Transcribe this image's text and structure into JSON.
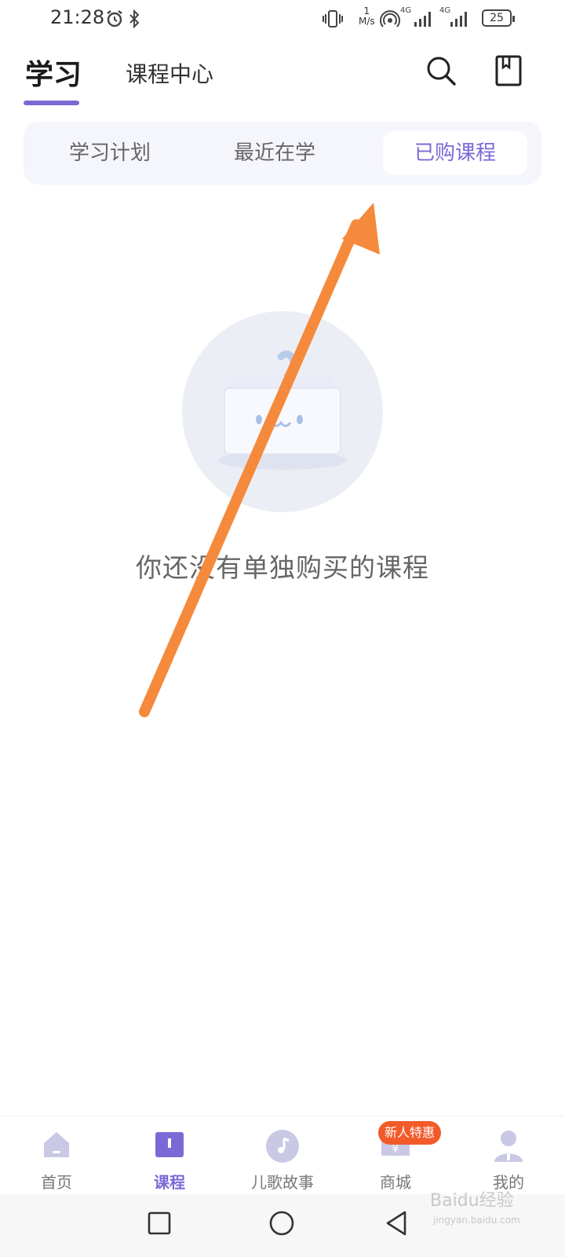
{
  "status_bar": {
    "time": "21:28",
    "net_speed_value": "1",
    "net_speed_unit": "M/s",
    "signal1_label": "4G",
    "signal2_label": "4G",
    "battery": "25",
    "icons": [
      "alarm-icon",
      "bluetooth-icon",
      "vibrate-icon",
      "hotspot-icon",
      "signal-icon",
      "signal-icon",
      "battery-icon"
    ]
  },
  "header": {
    "tabs": [
      {
        "label": "学习",
        "active": true
      },
      {
        "label": "课程中心",
        "active": false
      }
    ],
    "icons": [
      "search-icon",
      "bookmark-icon"
    ]
  },
  "segments": [
    {
      "label": "学习计划",
      "selected": false
    },
    {
      "label": "最近在学",
      "selected": false
    },
    {
      "label": "已购课程",
      "selected": true
    }
  ],
  "empty_state": {
    "message": "你还没有单独购买的课程",
    "illustration": "empty-box-illustration"
  },
  "bottom_nav": {
    "items": [
      {
        "label": "首页",
        "icon": "home-icon",
        "active": false
      },
      {
        "label": "课程",
        "icon": "book-icon",
        "active": true
      },
      {
        "label": "儿歌故事",
        "icon": "music-icon",
        "active": false
      },
      {
        "label": "商城",
        "icon": "shop-icon",
        "active": false
      },
      {
        "label": "我的",
        "icon": "profile-icon",
        "active": false
      }
    ],
    "promo_badge": "新人特惠"
  },
  "system_nav": {
    "icons": [
      "recents-button",
      "home-button",
      "back-button"
    ]
  },
  "watermark": {
    "text": "Baidu经验",
    "sub": "jingyan.baidu.com"
  },
  "colors": {
    "accent": "#7b6ad6",
    "promo": "#f25a2a",
    "annotation_arrow": "#f58a3c",
    "segment_bg": "#f5f6fc"
  }
}
